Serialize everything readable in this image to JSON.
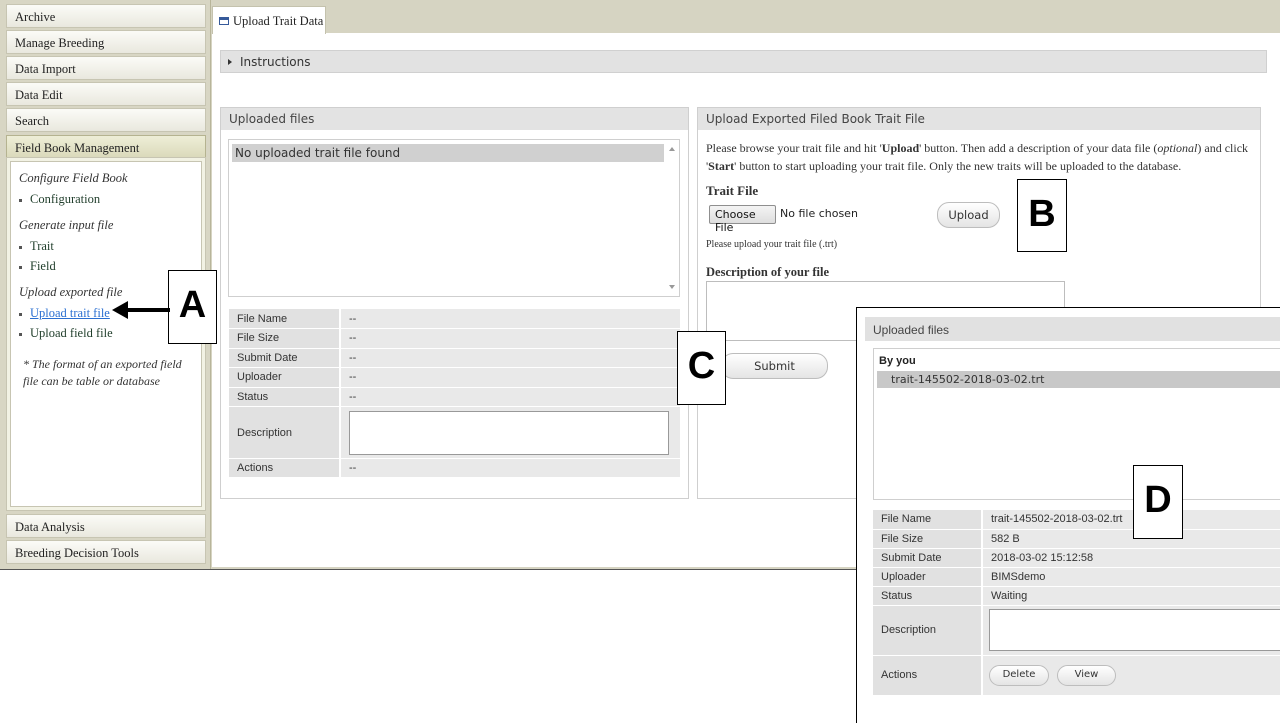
{
  "left_menu": {
    "headers": [
      "Archive",
      "Manage Breeding",
      "Data Import",
      "Data Edit",
      "Search",
      "Field Book Management"
    ],
    "bottom_headers": [
      "Data Analysis",
      "Breeding Decision Tools"
    ],
    "field_book": {
      "section1": "Configure Field Book",
      "item_configuration": "Configuration",
      "section2": "Generate input file",
      "item_trait": "Trait",
      "item_field": "Field",
      "section3": "Upload exported file",
      "item_upload_trait": "Upload trait file",
      "item_upload_field": "Upload field file",
      "note": "* The format of an exported field file can be table or database"
    }
  },
  "tab": {
    "label": "Upload Trait Data"
  },
  "instructions": {
    "label": "Instructions"
  },
  "uploaded_panel": {
    "title": "Uploaded files",
    "empty_message": "No uploaded trait file found",
    "rows": [
      {
        "key": "File Name",
        "value": "--"
      },
      {
        "key": "File Size",
        "value": "--"
      },
      {
        "key": "Submit Date",
        "value": "--"
      },
      {
        "key": "Uploader",
        "value": "--"
      },
      {
        "key": "Status",
        "value": "--"
      }
    ],
    "description_label": "Description",
    "actions_label": "Actions",
    "actions_value": "--"
  },
  "upload_panel": {
    "title": "Upload Exported Filed Book Trait File",
    "text_a": "Please browse your trait file and hit '",
    "text_upload": "Upload",
    "text_b": "' button. Then add a description of your data file (",
    "text_optional": "optional",
    "text_c": ") and click '",
    "text_start": "Start",
    "text_d": "' button to start uploading your trait file. Only the new traits will be uploaded to the database.",
    "trait_file_label": "Trait File",
    "choose_file": "Choose File",
    "no_file": "No file chosen",
    "upload_button": "Upload",
    "hint": "Please upload your trait file (.trt)",
    "description_label": "Description of your file",
    "submit_button": "Submit"
  },
  "callouts": {
    "a": "A",
    "b": "B",
    "c": "C",
    "d": "D"
  },
  "overlay": {
    "title": "Uploaded files",
    "group": "By you",
    "item": "trait-145502-2018-03-02.trt",
    "rows": [
      {
        "key": "File Name",
        "value": "trait-145502-2018-03-02.trt"
      },
      {
        "key": "File Size",
        "value": "582 B"
      },
      {
        "key": "Submit Date",
        "value": "2018-03-02 15:12:58"
      },
      {
        "key": "Uploader",
        "value": "BIMSdemo"
      },
      {
        "key": "Status",
        "value": "Waiting"
      }
    ],
    "description_label": "Description",
    "actions_label": "Actions",
    "delete_button": "Delete",
    "view_button": "View"
  },
  "icons": [
    "tab-window-icon",
    "expand-arrow-icon",
    "left-arrow-icon",
    "scroll-up-icon",
    "scroll-down-icon"
  ]
}
